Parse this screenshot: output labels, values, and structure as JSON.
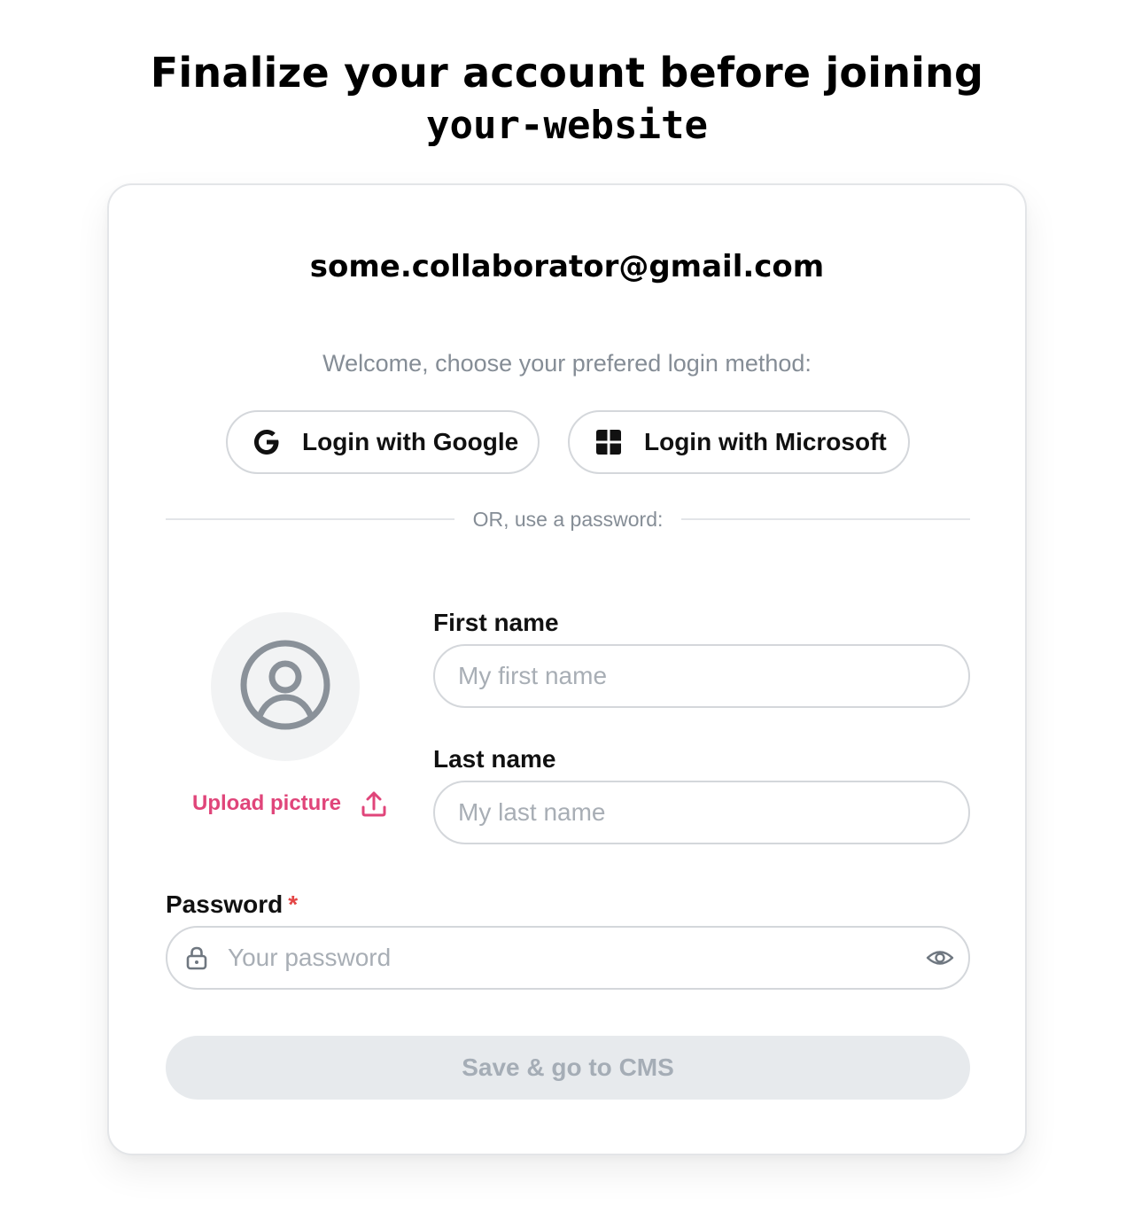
{
  "heading": {
    "line1": "Finalize your account before joining",
    "line2": "your-website"
  },
  "card": {
    "email": "some.collaborator@gmail.com",
    "welcome_text": "Welcome, choose your prefered login method:",
    "sso": {
      "google_label": "Login with Google",
      "google_icon": "google-g-icon",
      "microsoft_label": "Login with Microsoft",
      "microsoft_icon": "windows-icon"
    },
    "divider_text": "OR, use a password:",
    "avatar": {
      "icon": "user-circle-icon",
      "upload_label": "Upload picture",
      "upload_icon": "upload-icon"
    },
    "first_name": {
      "label": "First name",
      "placeholder": "My first name",
      "value": ""
    },
    "last_name": {
      "label": "Last name",
      "placeholder": "My last name",
      "value": ""
    },
    "password": {
      "label": "Password",
      "required_marker": "*",
      "placeholder": "Your password",
      "value": "",
      "lock_icon": "lock-icon",
      "toggle_icon": "eye-icon"
    },
    "submit_label": "Save & go to CMS"
  },
  "colors": {
    "accent_pink": "#e0457a",
    "required_red": "#e34545",
    "muted_text": "#858d96",
    "border": "#d4d7db",
    "disabled_button_bg": "#e7eaed",
    "disabled_button_text": "#a5adb6"
  }
}
